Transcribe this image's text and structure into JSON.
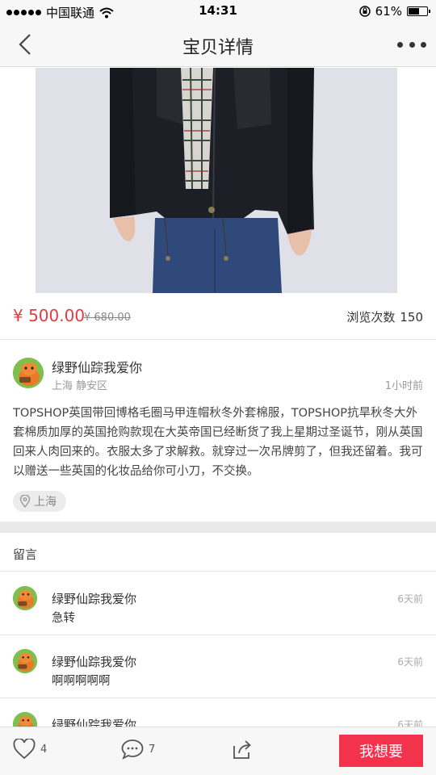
{
  "status_bar": {
    "carrier": "中国联通",
    "time": "14:31",
    "battery": "61%",
    "battery_level": 0.61
  },
  "nav": {
    "title": "宝贝详情"
  },
  "product": {
    "price": "¥ 500.00",
    "original_price": "¥ 680.00",
    "views_label": "浏览次数",
    "views_count": "150"
  },
  "seller": {
    "name": "绿野仙踪我爱你",
    "location": "上海 静安区",
    "time": "1小时前"
  },
  "description": "TOPSHOP英国带回博格毛圈马甲连帽秋冬外套棉服，TOPSHOP抗旱秋冬大外套棉质加厚的英国抢购款现在大英帝国已经断货了我上星期过圣诞节，刚从英国回来人肉回来的。衣服太多了求解救。就穿过一次吊牌剪了，但我还留着。我可以赠送一些英国的化妆品给你可小刀，不交换。",
  "location_tag": "上海",
  "comments_title": "留言",
  "comments": [
    {
      "name": "绿野仙踪我爱你",
      "text": "急转",
      "time": "6天前"
    },
    {
      "name": "绿野仙踪我爱你",
      "text": "啊啊啊啊啊",
      "time": "6天前"
    },
    {
      "name": "绿野仙踪我爱你",
      "text": "",
      "time": "6天前"
    }
  ],
  "bottom_bar": {
    "likes": "4",
    "comments": "7",
    "want_label": "我想要"
  },
  "colors": {
    "price": "#e8393f",
    "want_button": "#f3334c",
    "avatar": "#7fbf4f"
  }
}
